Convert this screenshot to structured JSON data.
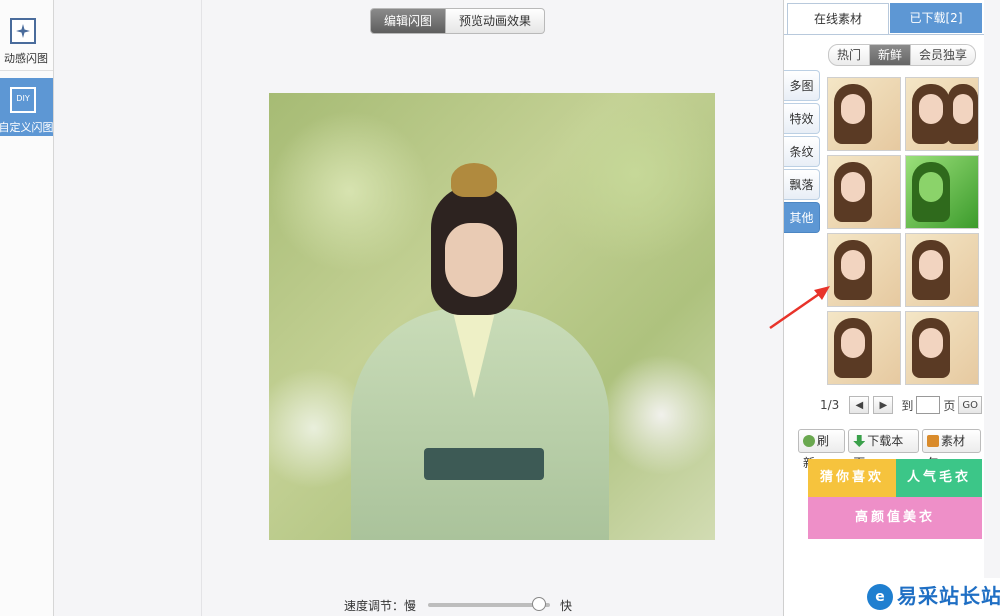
{
  "left_tools": [
    {
      "label": "动感闪图",
      "icon": "sparkle-frame-icon"
    },
    {
      "label": "自定义闪图",
      "icon_text": "DIY",
      "icon": "diy-icon"
    }
  ],
  "mode_tabs": {
    "edit": "编辑闪图",
    "preview": "预览动画效果"
  },
  "speed": {
    "label": "速度调节：",
    "slow": "慢",
    "fast": "快",
    "level": 0.85
  },
  "panel": {
    "tabs": {
      "online": "在线素材",
      "downloaded": "已下载[2]"
    },
    "segments": [
      "热门",
      "新鲜",
      "会员独享"
    ],
    "categories": [
      "多图",
      "特效",
      "条纹",
      "飘落",
      "其他"
    ],
    "pager": {
      "current": "1/3",
      "goto_label": "到",
      "page_suffix": "页",
      "go": "GO",
      "prev": "◀",
      "next": "▶"
    },
    "actions": [
      "刷新",
      "下载本页",
      "素材包"
    ],
    "banners": [
      "猜你喜欢",
      "人气毛衣",
      "高颜值美衣"
    ]
  },
  "watermark": {
    "text": "易采站长站"
  },
  "colors": {
    "accent_blue": "#5d97d4",
    "arrow_red": "#e8332a"
  }
}
